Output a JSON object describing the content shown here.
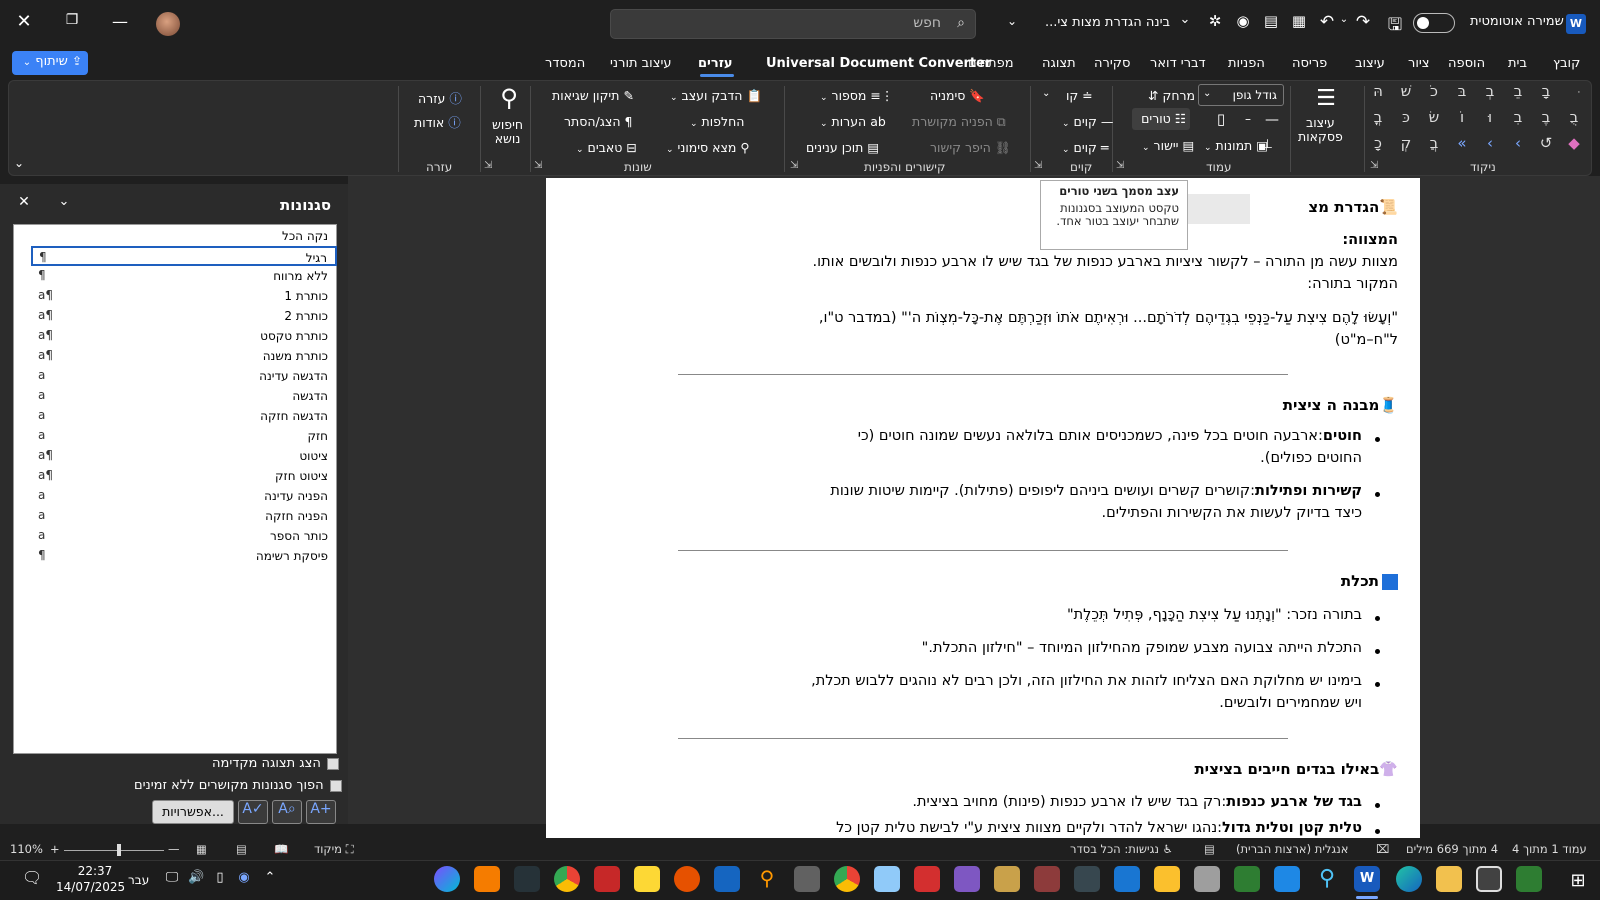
{
  "titlebar": {
    "autosave_label": "שמירה אוטומטית",
    "doc_title": "בינה הגדרת מצות צי...",
    "search_placeholder": "חפש",
    "app_icon": "word-app-icon",
    "autosave_on": true
  },
  "tabs": [
    "קובץ",
    "בית",
    "הוספה",
    "ציור",
    "עיצוב",
    "פריסה",
    "הפניות",
    "דברי דואר",
    "סקירה",
    "תצוגה",
    "מפתחים",
    "Universal Document Converter",
    "עזרים",
    "עיצוב תורני",
    "המסדר"
  ],
  "active_tab": "עזרים",
  "share_label": "שיתוף",
  "ribbon": {
    "group_nikud": "ניקוד",
    "paragraph_styles": "עיצוב\nפסקאות",
    "font_size": "גודל גופן",
    "gap": "מרחק",
    "columns": "טורים",
    "align": "יישור",
    "images": "תמונות",
    "group_column": "עמוד",
    "line": "קו",
    "lines1": "קוים",
    "lines2": "קוים",
    "group_lines": "קוים",
    "bookmark": "סימניה",
    "crossref": "הפניה מקושרת",
    "hyperlink": "היפר קישור",
    "numbering": "מספור",
    "notes": "הערות",
    "toc": "תוכן ענינים",
    "group_links": "קישורים והפניות",
    "paste_format": "הדבק ועצב",
    "replace": "החלפות",
    "find_mark": "מצא סימוני",
    "fix_errors": "תיקון שגיאות",
    "show_hide": "הצג/הסתר",
    "tabs_btn": "טאבים",
    "group_misc": "שונות",
    "search_topic": "חיפוש\nנושא",
    "help": "עזרה",
    "about": "אודות",
    "group_help": "עזרה"
  },
  "styles_pane": {
    "title": "סגנונות",
    "items": [
      {
        "name": "נקה הכל",
        "sym": ""
      },
      {
        "name": "רגיל",
        "sym": "¶"
      },
      {
        "name": "ללא מרווח",
        "sym": "¶"
      },
      {
        "name": "כותרת 1",
        "sym": "¶a"
      },
      {
        "name": "כותרת 2",
        "sym": "¶a"
      },
      {
        "name": "כותרת טקסט",
        "sym": "¶a"
      },
      {
        "name": "כותרת משנה",
        "sym": "¶a"
      },
      {
        "name": "הדגשה עדינה",
        "sym": "a"
      },
      {
        "name": "הדגשה",
        "sym": "a"
      },
      {
        "name": "הדגשה חזקה",
        "sym": "a"
      },
      {
        "name": "חזק",
        "sym": "a"
      },
      {
        "name": "ציטוט",
        "sym": "¶a"
      },
      {
        "name": "ציטוט חזק",
        "sym": "¶a"
      },
      {
        "name": "הפניה עדינה",
        "sym": "a"
      },
      {
        "name": "הפניה חזקה",
        "sym": "a"
      },
      {
        "name": "כותר הספר",
        "sym": "a"
      },
      {
        "name": "פיסקת רשימה",
        "sym": "¶"
      }
    ],
    "selected_index": 1,
    "show_preview": "הצג תצוגה מקדימה",
    "disable_linked": "הפוך סגנונות מקושרים ללא זמינים",
    "options": "אפשרויות..."
  },
  "tooltip": {
    "title": "עצב מסמך בשני טורים",
    "body": "טקסט המעוצב בסגנונות שתבחר יעוצב בטור אחד."
  },
  "document": {
    "h1": "הגדרת מצ",
    "mitzva_label": "המצווה:",
    "mitzva_text": "מצוות עשה מן התורה – לקשור ציציות בארבע כנפות של בגד שיש לו ארבע כנפות ולובשים אותו.",
    "source_label": "המקור בתורה:",
    "quote1": "\"וְעָשׂוּ לָהֶם צִיצִת עַל-כַּנְפֵי בִגְדֵיהֶם לְדֹרֹתָם... וּרְאִיתֶם אֹתוֹ וּזְכַרְתֶּם אֶת-כָּל-מִצְוֹת ה'\" (במדבר ט\"ו,",
    "quote2": "ל\"ח–מ\"ט)",
    "h2": "מבנה ה ציצית",
    "b1_bold": "חוטים",
    "b1_text": ":ארבעה חוטים בכל פינה, כשמכניסים אותם בלולאה נעשים שמונה חוטים (כי",
    "b1_text2": "החוטים כפולים).",
    "b2_bold": "קשירות ופתילות",
    "b2_text": ":קושרים קשרים ועושים ביניהם ליפופים (פתילות). קיימות שיטות שונות",
    "b2_text2": "כיצד בדיוק לעשות את הקשירות והפתילים.",
    "h3": "תכלת",
    "t1": "בתורה נזכר: \"וְנָתְנוּ עַל צִיצִת הַכָּנָף, פְּתִיל תְּכֵלֶת\"",
    "t2": "התכלת הייתה צבועה מצבע שמופק מהחילזון המיוחד – \"חילזון התכלת.\"",
    "t3": "בימינו יש מחלוקת האם הצליחו לזהות את החילזון הזה, ולכן רבים לא נוהגים ללבוש תכלת,",
    "t3b": "ויש שמחמירים ולובשים.",
    "h4": "באילו בגדים חייבים בציצית",
    "g1_bold": "בגד של ארבע כנפות",
    "g1_text": ":רק בגד שיש לו ארבע כנפות (פינות) מחויב בציצית.",
    "g2_bold": "טלית קטן וטלית גדול",
    "g2_text": ":נהגו ישראל להדר ולקיים מצוות ציצית ע\"י לבישת טלית קטן כל"
  },
  "statusbar": {
    "page": "עמוד 1 מתוך 4",
    "words": "4 מתוך 669 מילים",
    "lang": "אנגלית (ארצות הברית)",
    "access": "נגישות: הכל בסדר",
    "focus": "מיקוד",
    "zoom": "110%",
    "zoom_fraction": 0.55
  },
  "taskbar": {
    "time": "22:37",
    "date": "14/07/2025",
    "lang": "עבר"
  },
  "colors": {
    "word_blue": "#185abd",
    "accent": "#4a8be8",
    "share": "#3b82f6"
  }
}
